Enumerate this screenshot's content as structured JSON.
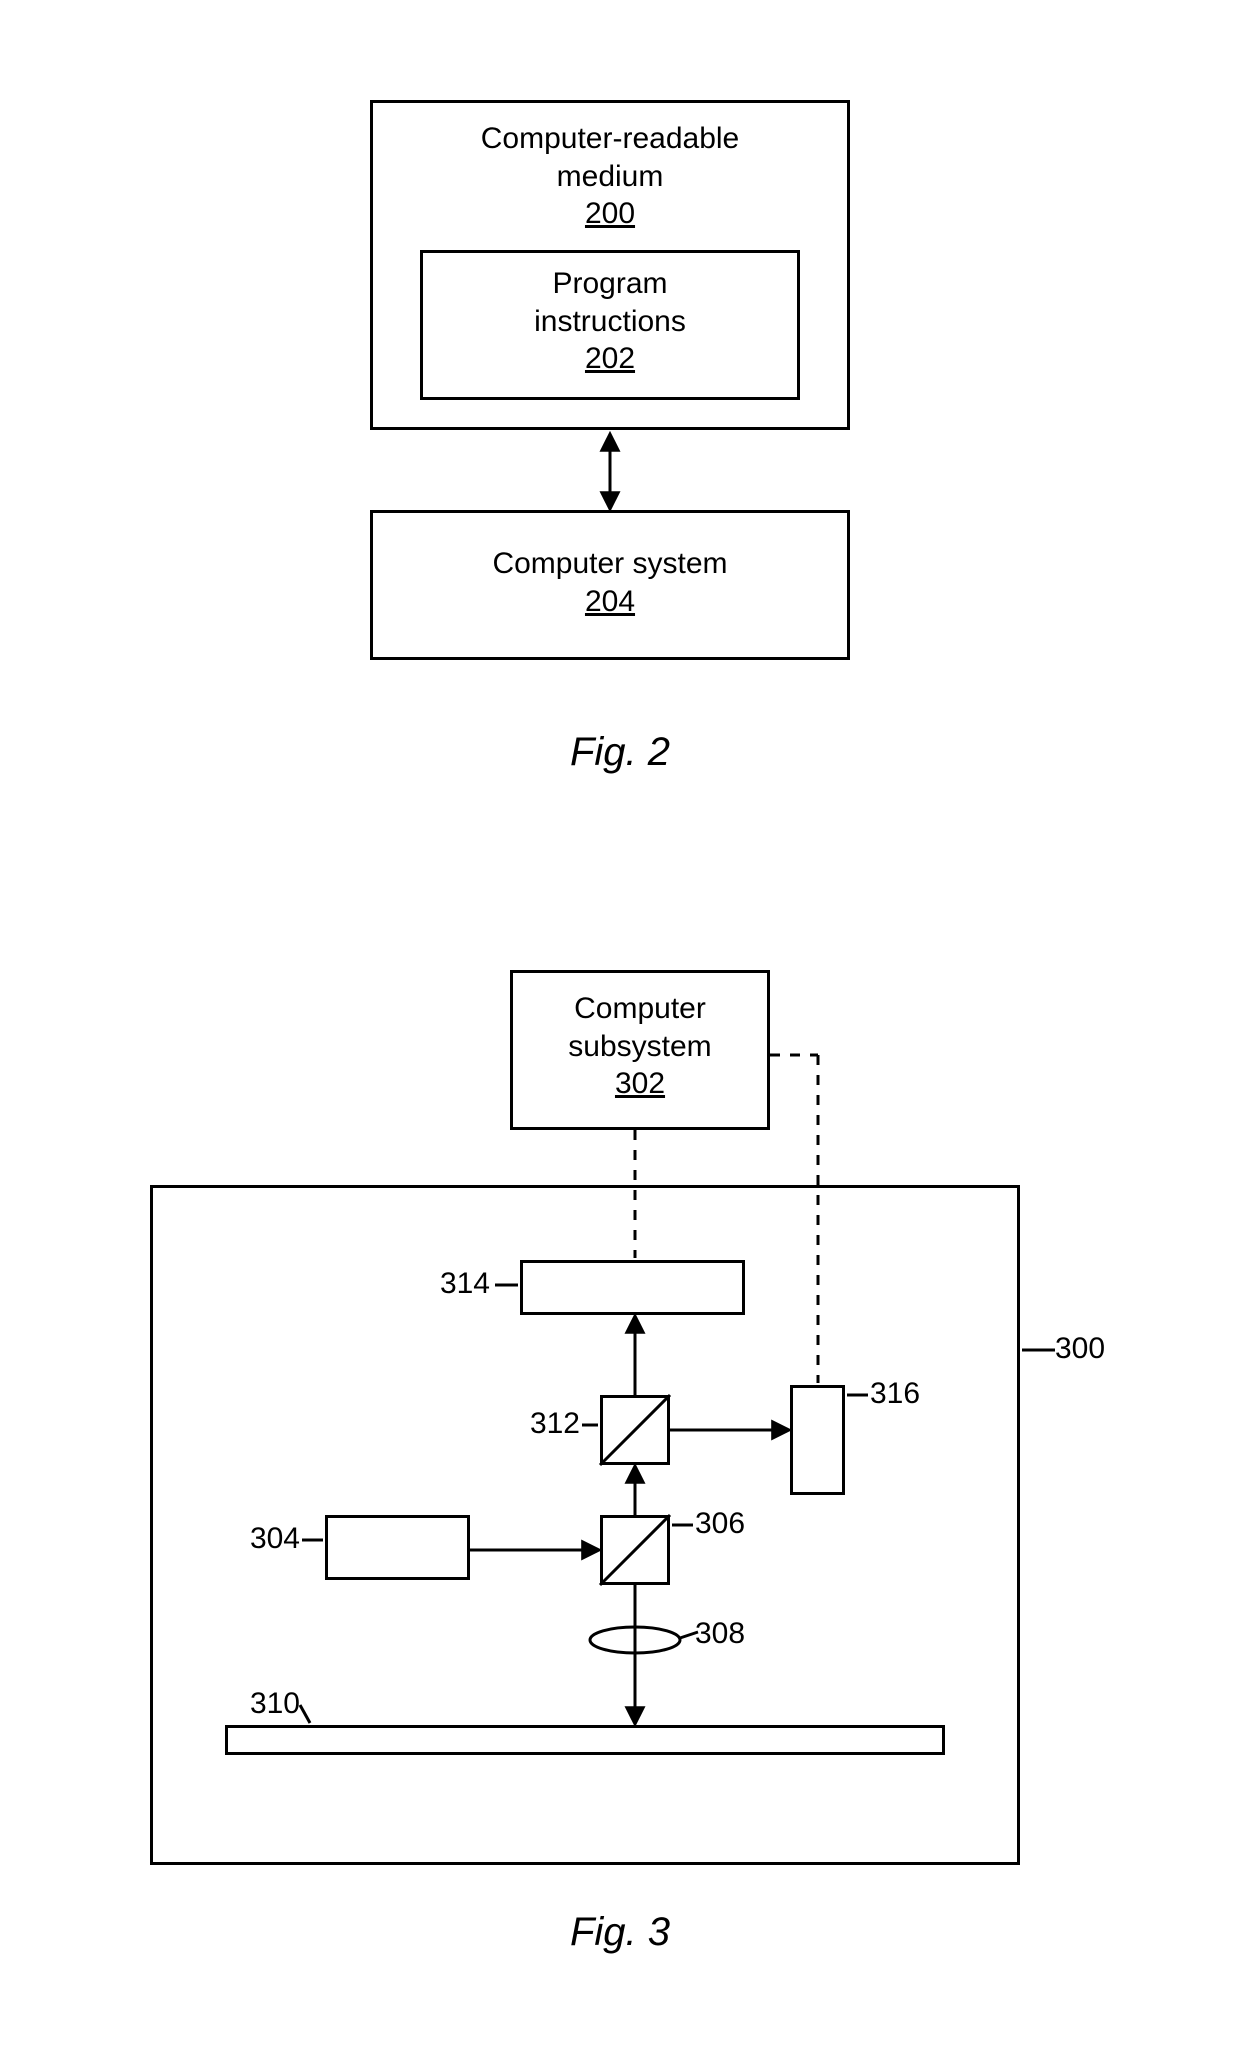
{
  "fig2": {
    "caption": "Fig. 2",
    "outer_box": {
      "line1": "Computer-readable",
      "line2": "medium",
      "number": "200"
    },
    "inner_box": {
      "line1": "Program",
      "line2": "instructions",
      "number": "202"
    },
    "computer_system": {
      "line1": "Computer system",
      "number": "204"
    }
  },
  "fig3": {
    "caption": "Fig. 3",
    "computer_subsystem": {
      "line1": "Computer",
      "line2": "subsystem",
      "number": "302"
    },
    "labels": {
      "l300": "300",
      "l304": "304",
      "l306": "306",
      "l308": "308",
      "l310": "310",
      "l312": "312",
      "l314": "314",
      "l316": "316"
    }
  }
}
